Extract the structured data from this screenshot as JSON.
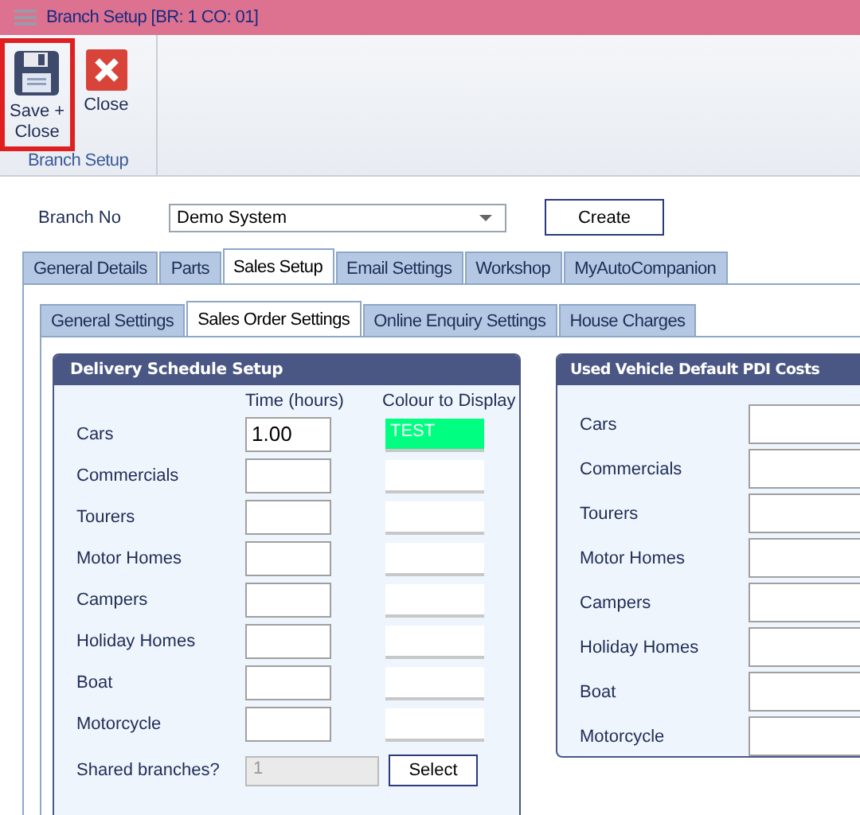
{
  "window": {
    "title": "Branch Setup [BR: 1 CO: 01]"
  },
  "ribbon": {
    "buttons": [
      {
        "kind": "save",
        "label": "Save +\nClose",
        "highlighted": true
      },
      {
        "kind": "close",
        "label": "Close",
        "highlighted": false
      }
    ],
    "group_label": "Branch Setup"
  },
  "branch": {
    "label": "Branch No",
    "value": "Demo System",
    "button": "Create"
  },
  "tabs": [
    {
      "label": "General Details",
      "selected": false
    },
    {
      "label": "Parts",
      "selected": false
    },
    {
      "label": "Sales Setup",
      "selected": true
    },
    {
      "label": "Email Settings",
      "selected": false
    },
    {
      "label": "Workshop",
      "selected": false
    },
    {
      "label": "MyAutoCompanion",
      "selected": false
    }
  ],
  "subtabs": [
    {
      "label": "General Settings",
      "selected": false
    },
    {
      "label": "Sales Order Settings",
      "selected": true
    },
    {
      "label": "Online Enquiry Settings",
      "selected": false
    },
    {
      "label": "House Charges",
      "selected": false
    }
  ],
  "delivery": {
    "title": "Delivery Schedule Setup",
    "columns": [
      "Time (hours)",
      "Colour to Display"
    ],
    "rows": [
      {
        "label": "Cars",
        "time": "1.00",
        "colour_text": "TEST",
        "color": "#00ff80"
      },
      {
        "label": "Commercials"
      },
      {
        "label": "Tourers"
      },
      {
        "label": "Motor Homes"
      },
      {
        "label": "Campers"
      },
      {
        "label": "Holiday Homes"
      },
      {
        "label": "Boat"
      },
      {
        "label": "Motorcycle"
      }
    ],
    "shared_label": "Shared  branches?",
    "shared_value": "1",
    "shared_disabled": true,
    "select_button": "Select"
  },
  "pdi": {
    "title": "Used Vehicle Default PDI Costs",
    "rows": [
      {
        "label": "Cars"
      },
      {
        "label": "Commercials"
      },
      {
        "label": "Tourers"
      },
      {
        "label": "Motor Homes"
      },
      {
        "label": "Campers"
      },
      {
        "label": "Holiday Homes"
      },
      {
        "label": "Boat"
      },
      {
        "label": "Motorcycle"
      }
    ]
  }
}
